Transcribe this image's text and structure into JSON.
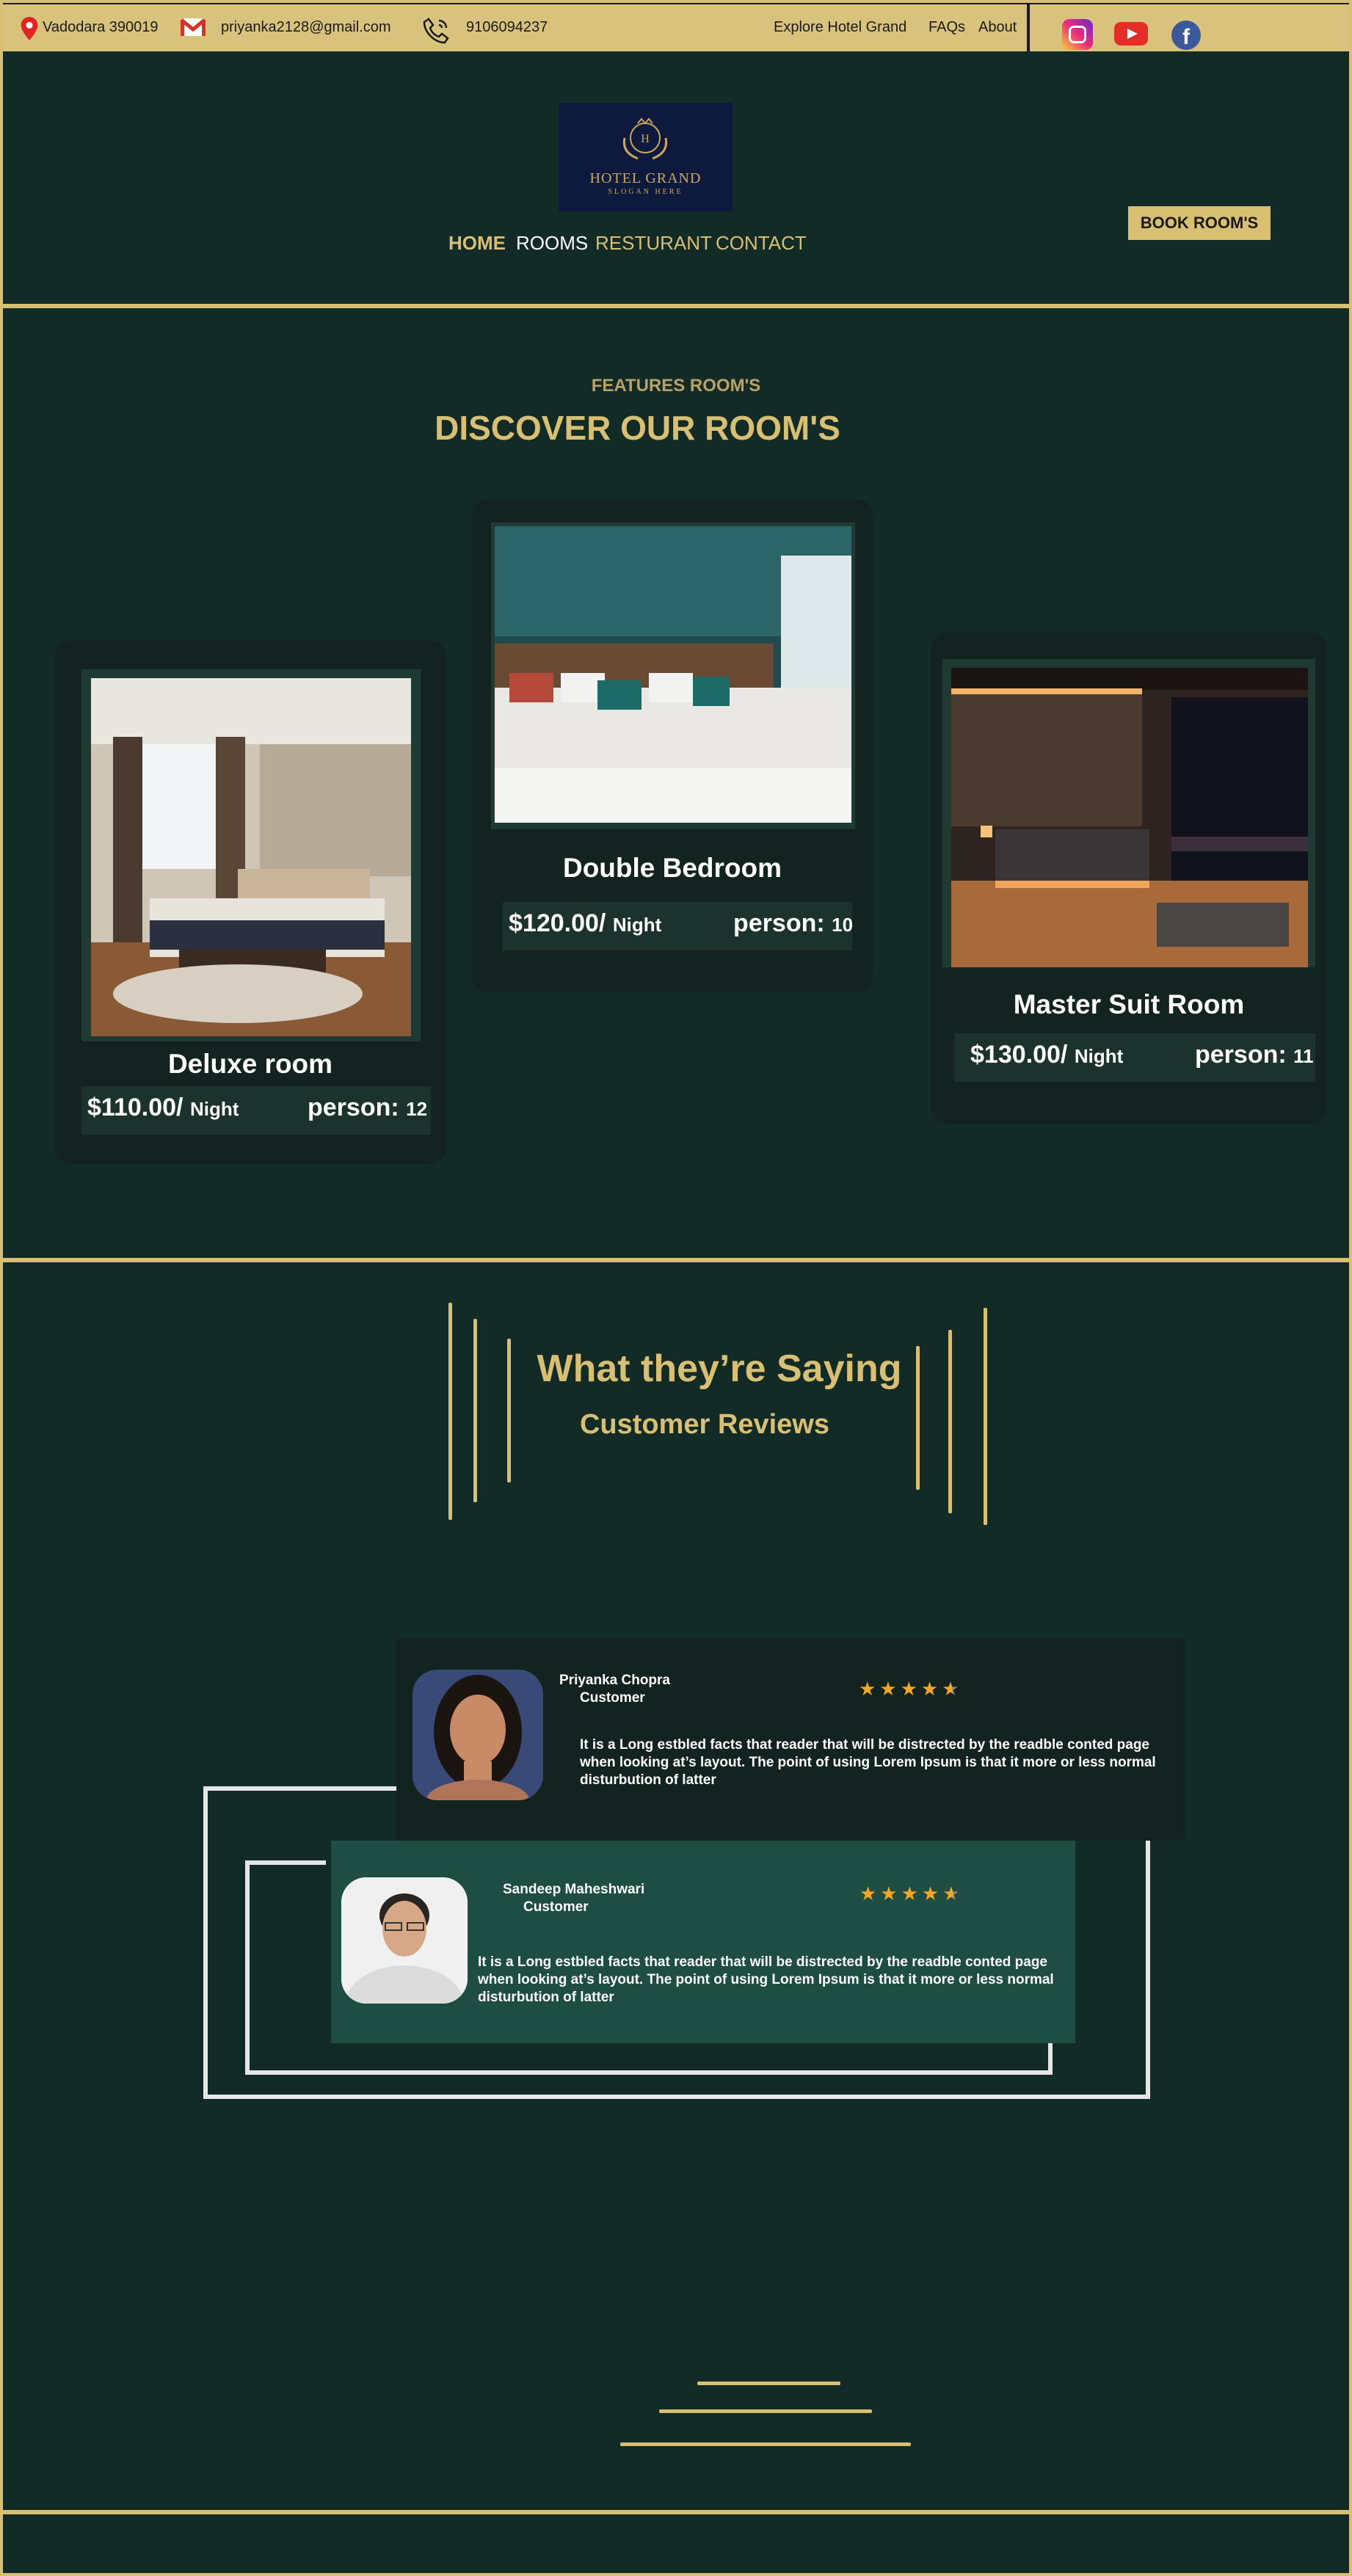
{
  "topbar": {
    "location": "Vadodara 390019",
    "email": "priyanka2128@gmail.com",
    "phone": "9106094237",
    "links": [
      "Explore Hotel Grand",
      "FAQs",
      "About"
    ]
  },
  "logo": {
    "name": "HOTEL GRAND",
    "slogan": "SLOGAN HERE"
  },
  "nav": {
    "items": [
      "HOME",
      "ROOMS",
      "RESTURANT",
      "CONTACT"
    ],
    "active": "HOME"
  },
  "book_button": "BOOK ROOM'S",
  "rooms_section": {
    "eyebrow": "FEATURES ROOM'S",
    "title": "DISCOVER OUR ROOM'S",
    "rooms": [
      {
        "name": "Deluxe room",
        "price": "$110.00/",
        "per": "Night",
        "person_label": "person:",
        "person": "12"
      },
      {
        "name": "Double Bedroom",
        "price": "$120.00/",
        "per": "Night",
        "person_label": "person:",
        "person": "10"
      },
      {
        "name": "Master Suit Room",
        "price": "$130.00/",
        "per": "Night",
        "person_label": "person:",
        "person": "11"
      }
    ]
  },
  "reviews": {
    "title": "What they’re Saying",
    "subtitle": "Customer Reviews",
    "items": [
      {
        "name": "Priyanka Chopra",
        "role": "Customer",
        "rating": 4.5,
        "text": "It is a Long  estbled facts that reader that will be distrected by the  readble conted page when looking at’s layout. The point of using Lorem Ipsum is that it more or less normal disturbution of latter"
      },
      {
        "name": "Sandeep Maheshwari",
        "role": "Customer",
        "rating": 4.5,
        "text": "It is a Long  estbled facts that reader that will be distrected by the  readble conted page when looking at’s layout. The point of using Lorem Ipsum is that it more or less normal disturbution of latter"
      }
    ]
  },
  "colors": {
    "background": "#122b27",
    "gold": "#d9bf72",
    "card": "#13231f",
    "review_dark": "#13231f",
    "review_green": "#1d4d43",
    "star": "#f5a623"
  },
  "icons": [
    "location-pin-icon",
    "gmail-icon",
    "phone-icon",
    "instagram-icon",
    "youtube-icon",
    "facebook-icon",
    "star-icon"
  ]
}
